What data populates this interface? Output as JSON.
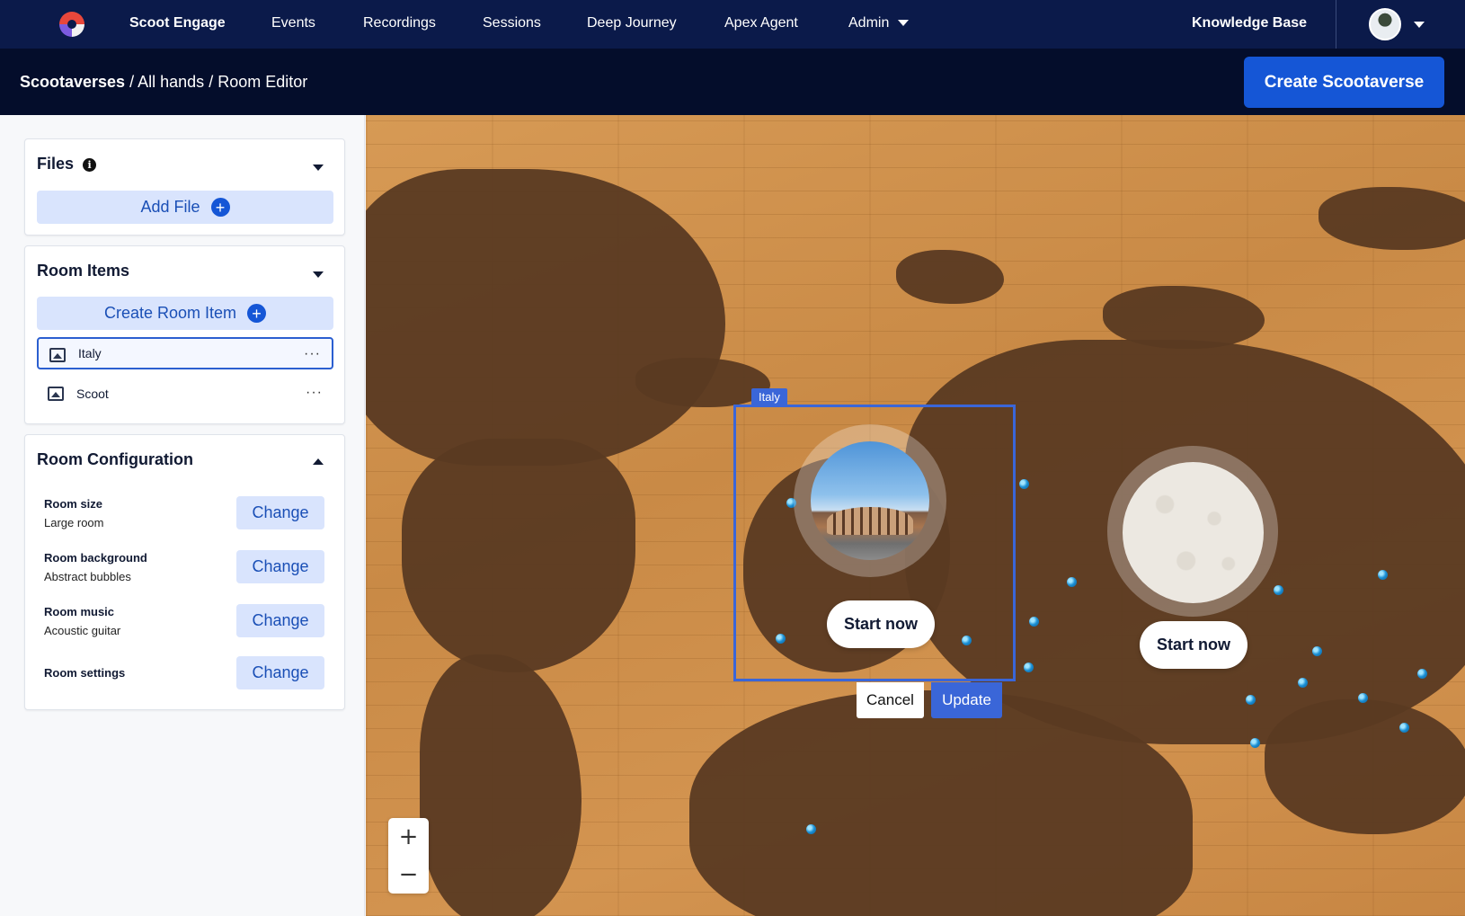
{
  "nav": {
    "brand": "Scoot Engage",
    "items": [
      "Events",
      "Recordings",
      "Sessions",
      "Deep Journey",
      "Apex Agent",
      "Admin"
    ],
    "knowledge_base": "Knowledge Base"
  },
  "breadcrumb": {
    "root": "Scootaverses",
    "sep": "/",
    "middle": "All hands",
    "current": "Room Editor"
  },
  "header": {
    "create_label": "Create Scootaverse"
  },
  "files": {
    "title": "Files",
    "info_glyph": "i",
    "add_label": "Add File"
  },
  "room_items": {
    "title": "Room Items",
    "create_label": "Create Room Item",
    "items": [
      {
        "label": "Italy",
        "more": "···"
      },
      {
        "label": "Scoot",
        "more": "···"
      }
    ]
  },
  "room_config": {
    "title": "Room Configuration",
    "change_label": "Change",
    "rows": [
      {
        "label": "Room size",
        "value": "Large room"
      },
      {
        "label": "Room background",
        "value": "Abstract bubbles"
      },
      {
        "label": "Room music",
        "value": "Acoustic guitar"
      },
      {
        "label": "Room settings",
        "value": ""
      }
    ]
  },
  "canvas": {
    "selected_tag": "Italy",
    "start_label": "Start now",
    "cancel_label": "Cancel",
    "update_label": "Update",
    "zoom_in": "+",
    "zoom_out": "−"
  },
  "icons": {
    "plus": "+",
    "logo": "scoot-logo-icon",
    "image": "image-icon",
    "caret": "caret-down-icon"
  },
  "colors": {
    "nav_bg": "#0b1a4a",
    "subheader_bg": "#040d2b",
    "primary": "#1556d6",
    "selection": "#3a66d8",
    "soft_button": "#d9e4fd"
  }
}
